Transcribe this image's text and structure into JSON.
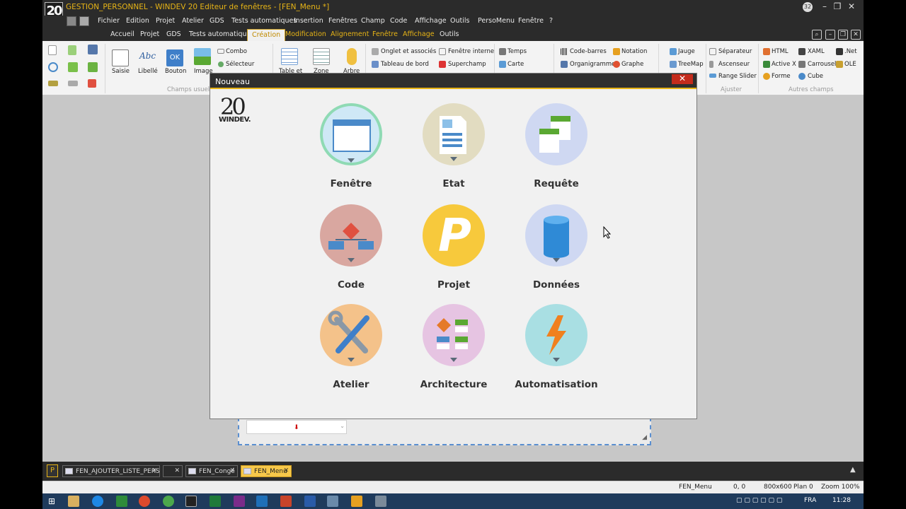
{
  "app": {
    "logo": "20",
    "title": "GESTION_PERSONNEL - WINDEV 20  Editeur de fenêtres - [FEN_Menu *]",
    "badge": "32"
  },
  "menu": [
    "Fichier",
    "Edition",
    "Projet",
    "Atelier",
    "GDS",
    "Tests automatiques",
    "Insertion",
    "Fenêtres",
    "Champ",
    "Code",
    "Affichage",
    "Outils",
    "PersoMenu",
    "Fenêtre",
    "?"
  ],
  "tabs": [
    {
      "label": "Accueil",
      "style": "normal"
    },
    {
      "label": "Projet",
      "style": "normal"
    },
    {
      "label": "GDS",
      "style": "normal"
    },
    {
      "label": "Tests automatiques",
      "style": "normal"
    },
    {
      "label": "Création",
      "style": "active"
    },
    {
      "label": "Modification",
      "style": "orange"
    },
    {
      "label": "Alignement",
      "style": "orange"
    },
    {
      "label": "Fenêtre",
      "style": "orange"
    },
    {
      "label": "Affichage",
      "style": "orange"
    },
    {
      "label": "Outils",
      "style": "normal"
    }
  ],
  "ribbon": {
    "big": {
      "saisie": "Saisie",
      "libelle": "Libellé",
      "bouton": "Bouton",
      "image": "Image",
      "table": "Table et",
      "zone": "Zone",
      "arbre": "Arbre",
      "abc": "Abc",
      "ok": "OK"
    },
    "small": {
      "combo": "Combo",
      "selecteur": "Sélecteur",
      "onglet": "Onglet et associés",
      "fenetre_interne": "Fenêtre interne",
      "tableau_bord": "Tableau de bord",
      "superchamp": "Superchamp",
      "temps": "Temps",
      "carte": "Carte",
      "code_barres": "Code-barres",
      "notation": "Notation",
      "organigramme": "Organigramme",
      "graphe": "Graphe",
      "jauge": "Jauge",
      "treemap": "TreeMap",
      "separateur": "Séparateur",
      "ascenseur": "Ascenseur",
      "range_slider": "Range Slider",
      "html": "HTML",
      "xaml": "XAML",
      "net": ".Net",
      "activex": "Active X",
      "carrousel": "Carrousel",
      "ole": "OLE",
      "forme": "Forme",
      "cube": "Cube"
    },
    "groups": {
      "champs_usuels": "Champs usuels",
      "ajuster": "Ajuster",
      "autres_champs": "Autres champs"
    }
  },
  "dialog": {
    "title": "Nouveau",
    "close": "✕",
    "logo_big": "20",
    "logo_small": "WINDEV.",
    "tiles": {
      "fenetre": "Fenêtre",
      "etat": "Etat",
      "requete": "Requête",
      "code": "Code",
      "projet": "Projet",
      "donnees": "Données",
      "atelier": "Atelier",
      "architecture": "Architecture",
      "automatisation": "Automatisation"
    },
    "projet_letter": "P"
  },
  "doc_tabs": [
    "FEN_AJOUTER_LISTE_PERS",
    "FEN_Congé",
    "FEN_Menu"
  ],
  "status": {
    "window": "FEN_Menu",
    "coords": "0, 0",
    "size": "800x600",
    "plan": "Plan 0",
    "zoom": "Zoom 100%"
  },
  "tray": {
    "lang": "FRA",
    "time": "11:28"
  },
  "colors": {
    "accent": "#e7b416",
    "close_red": "#c42b1c"
  }
}
